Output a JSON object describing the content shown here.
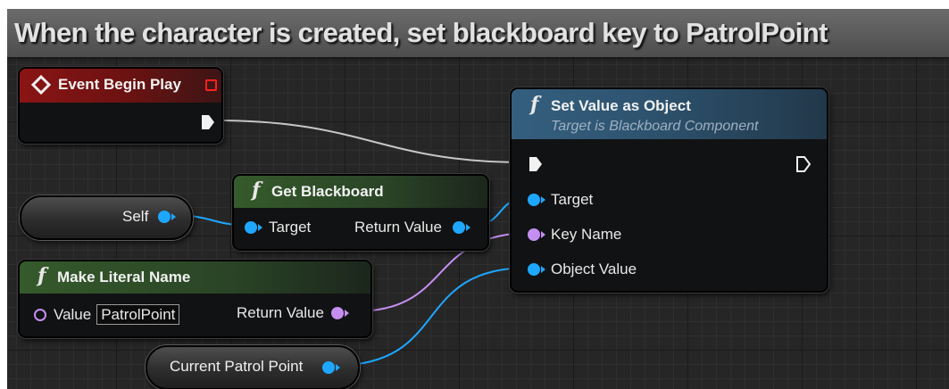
{
  "comment": {
    "text": "When the  character is created, set blackboard key to PatrolPoint"
  },
  "nodes": {
    "event_begin_play": {
      "title": "Event Begin Play"
    },
    "get_blackboard": {
      "title": "Get Blackboard",
      "target_label": "Target",
      "return_label": "Return Value"
    },
    "self_var": {
      "label": "Self"
    },
    "make_literal_name": {
      "title": "Make Literal Name",
      "value_label": "Value",
      "value": "PatrolPoint",
      "return_label": "Return Value"
    },
    "current_patrol_point_var": {
      "label": "Current Patrol Point"
    },
    "set_value_as_object": {
      "title": "Set Value as Object",
      "subtitle": "Target is Blackboard Component",
      "target_label": "Target",
      "key_name_label": "Key Name",
      "object_value_label": "Object Value"
    }
  },
  "function_glyph": "f",
  "colors": {
    "event_header": "#8a1414",
    "function_header": "#355a2b",
    "set_value_header": "#355f7f",
    "object_pin": "#1ea7ff",
    "name_pin": "#c58ff2",
    "exec_wire": "#d8d8d8"
  },
  "icons": {
    "event": "diamond-event-icon",
    "delegate": "red-square-delegate-icon",
    "function": "function-f-icon",
    "exec_in": "exec-pin-filled-icon",
    "exec_out": "exec-pin-hollow-icon"
  }
}
